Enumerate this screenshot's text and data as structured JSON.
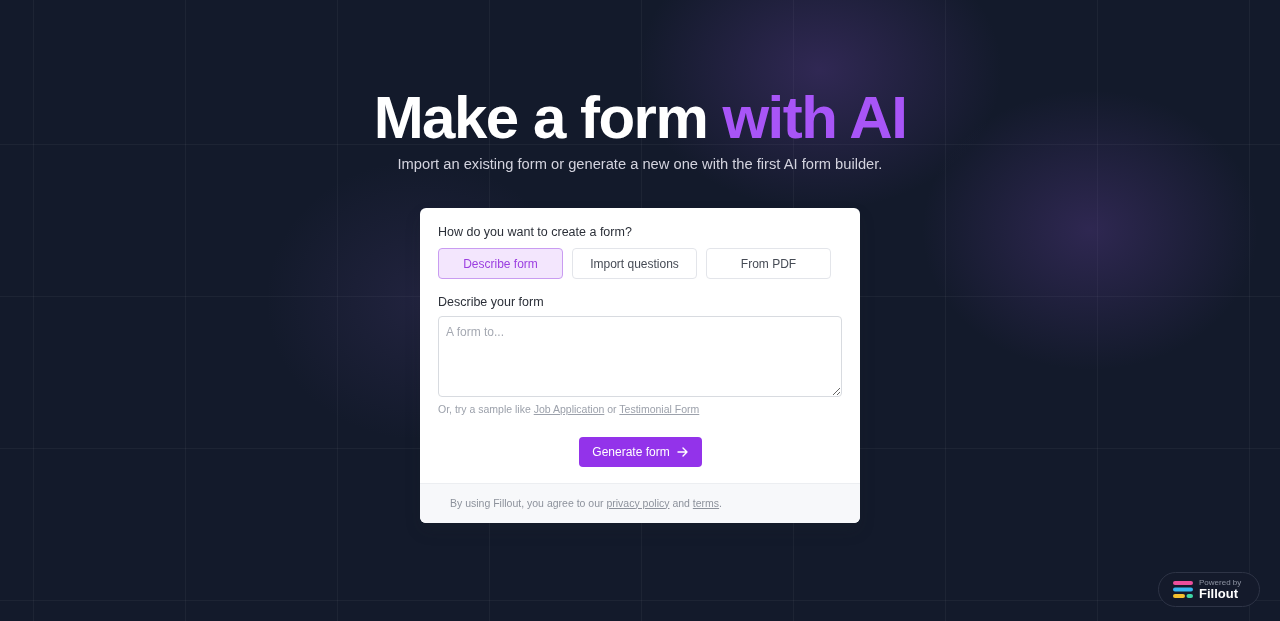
{
  "headline": {
    "text": "Make a form",
    "accent": "with AI"
  },
  "subtitle": "Import an existing form or generate a new one with the first AI form builder.",
  "form_card": {
    "question": "How do you want to create a form?",
    "options": [
      {
        "label": "Describe form",
        "selected": true
      },
      {
        "label": "Import questions",
        "selected": false
      },
      {
        "label": "From PDF",
        "selected": false
      }
    ],
    "description": {
      "label": "Describe your form",
      "placeholder": "A form to..."
    },
    "sample_hint": [
      {
        "kind": "text",
        "text": "Or, try a sample like"
      },
      {
        "kind": "link",
        "text": "Job Application"
      },
      {
        "kind": "text",
        "text": "or"
      },
      {
        "kind": "link",
        "text": "Testimonial Form"
      }
    ],
    "generate_button": "Generate form",
    "footer": [
      {
        "kind": "text",
        "text": "By using Fillout, you agree to our"
      },
      {
        "kind": "link",
        "text": "privacy policy"
      },
      {
        "kind": "text",
        "text": "and"
      },
      {
        "kind": "link",
        "text": "terms"
      },
      {
        "kind": "punct",
        "text": "."
      }
    ]
  },
  "powered_badge": {
    "caption": "Powered by",
    "brand": "Fillout"
  }
}
